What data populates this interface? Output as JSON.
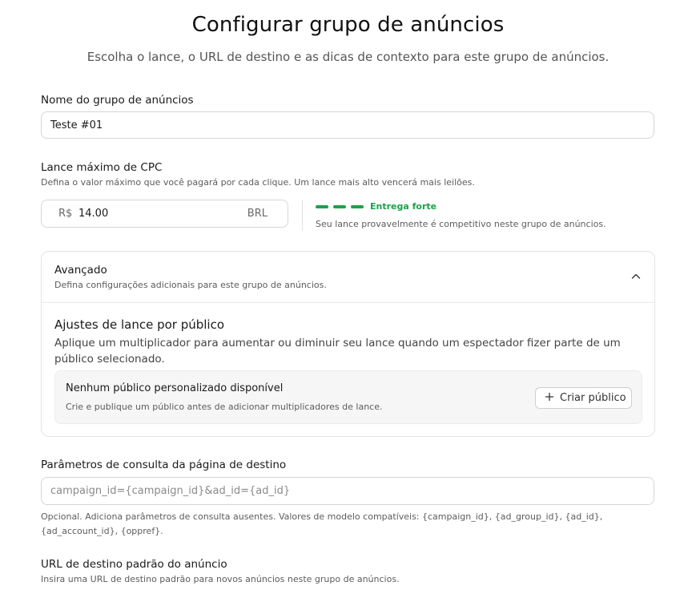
{
  "header": {
    "title": "Configurar grupo de anúncios",
    "subtitle": "Escolha o lance, o URL de destino e as dicas de contexto para este grupo de anúncios."
  },
  "ad_group_name": {
    "label": "Nome do grupo de anúncios",
    "value": "Teste #01"
  },
  "max_cpc": {
    "label": "Lance máximo de CPC",
    "help": "Defina o valor máximo que você pagará por cada clique. Um lance mais alto vencerá mais leilões.",
    "prefix": "R$",
    "value": "14.00",
    "suffix": "BRL",
    "delivery_label": "Entrega forte",
    "delivery_note": "Seu lance provavelmente é competitivo neste grupo de anúncios.",
    "delivery_color": "#1aa34a"
  },
  "advanced": {
    "title": "Avançado",
    "subtitle": "Defina configurações adicionais para este grupo de anúncios.",
    "expanded": true,
    "audience": {
      "title": "Ajustes de lance por público",
      "description": "Aplique um multiplicador para aumentar ou diminuir seu lance quando um espectador fizer parte de um público selecionado.",
      "empty_title": "Nenhum público personalizado disponível",
      "empty_subtitle": "Crie e publique um público antes de adicionar multiplicadores de lance.",
      "create_button": "Criar público"
    }
  },
  "query_params": {
    "label": "Parâmetros de consulta da página de destino",
    "placeholder": "campaign_id={campaign_id}&ad_id={ad_id}",
    "help": "Opcional. Adiciona parâmetros de consulta ausentes. Valores de modelo compatíveis: {campaign_id}, {ad_group_id}, {ad_id}, {ad_account_id}, {oppref}."
  },
  "default_url": {
    "label": "URL de destino padrão do anúncio",
    "help": "Insira uma URL de destino padrão para novos anúncios neste grupo de anúncios."
  },
  "icons": {
    "collapse": "chevron-up-icon",
    "add": "plus-icon"
  }
}
